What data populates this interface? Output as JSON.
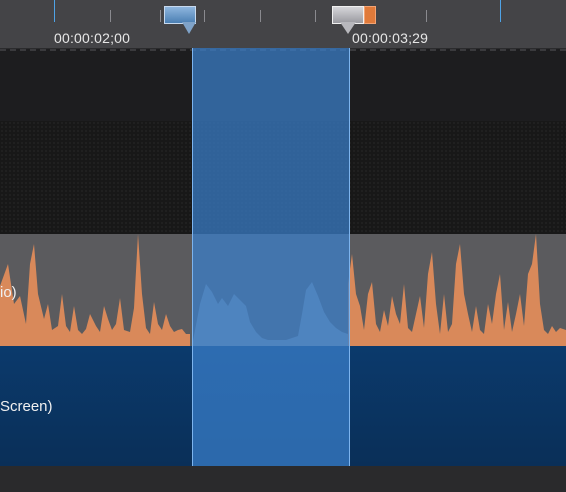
{
  "timeline": {
    "time_labels": [
      "00:00:02;00",
      "00:00:03;29"
    ],
    "tracks": [
      {
        "label": "io)"
      },
      {
        "label": "Screen)"
      }
    ]
  },
  "colors": {
    "audio_wave": "#d9895a",
    "selection": "#3a80cc",
    "screen_track": "#0b3a6c"
  },
  "icons": {
    "selection_start": "range-marker-icon",
    "playhead": "playhead-icon",
    "selection_end": "out-point-icon"
  }
}
